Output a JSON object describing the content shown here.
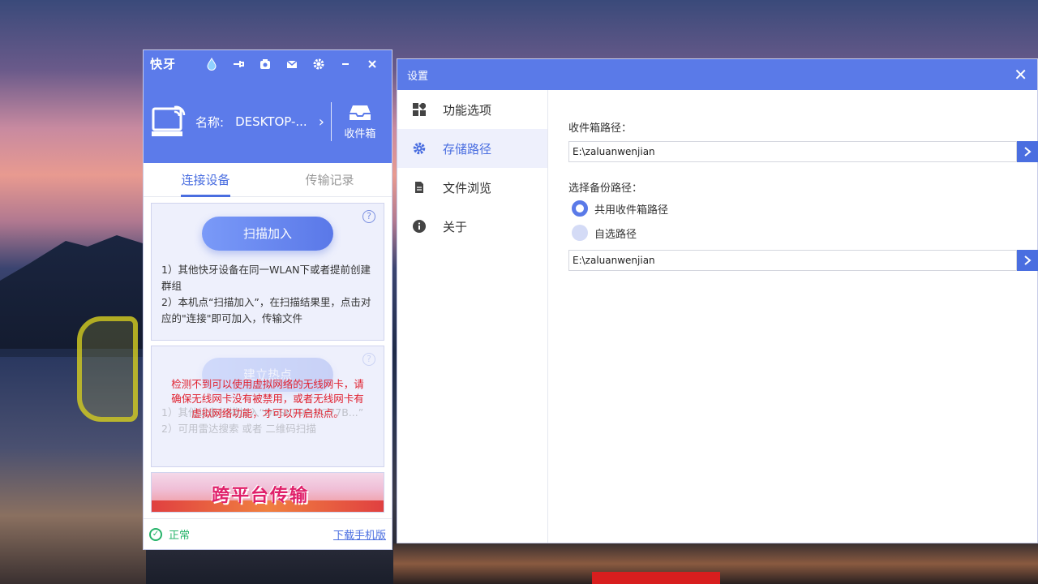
{
  "app": {
    "logo": "快牙",
    "device_label": "名称:",
    "device_name": "DESKTOP-...",
    "inbox_label": "收件箱",
    "tabs": [
      {
        "label": "连接设备"
      },
      {
        "label": "传输记录"
      }
    ],
    "card1": {
      "button": "扫描加入",
      "line1": "1）其他快牙设备在同一WLAN下或者提前创建群组",
      "line2": "2）本机点“扫描加入”，在扫描结果里，点击对应的\"连接\"即可加入，传输文件"
    },
    "card2": {
      "button": "建立热点",
      "line1": "1）其他设备扫描加入“DESKTOP-VO77B...”",
      "line2": "2）可用雷达搜索 或者 二维码扫描",
      "warning": "检测不到可以使用虚拟网络的无线网卡，请确保无线网卡没有被禁用，或者无线网卡有虚拟网络功能，才可以开启热点。"
    },
    "banner_text": "跨平台传输",
    "status": "正常",
    "download_link": "下载手机版"
  },
  "settings": {
    "title": "设置",
    "close": "✕",
    "nav": [
      {
        "label": "功能选项",
        "icon": "grid-icon"
      },
      {
        "label": "存储路径",
        "icon": "gear-icon"
      },
      {
        "label": "文件浏览",
        "icon": "document-icon"
      },
      {
        "label": "关于",
        "icon": "info-icon"
      }
    ],
    "inbox_path_label": "收件箱路径：",
    "inbox_path": "E:\\zaluanwenjian",
    "backup_label": "选择备份路径：",
    "radio_shared": "共用收件箱路径",
    "radio_custom": "自选路径",
    "backup_path": "E:\\zaluanwenjian"
  },
  "colors": {
    "accent": "#5c7bea",
    "status_green": "#26b36a",
    "warning_red": "#e0202e"
  }
}
